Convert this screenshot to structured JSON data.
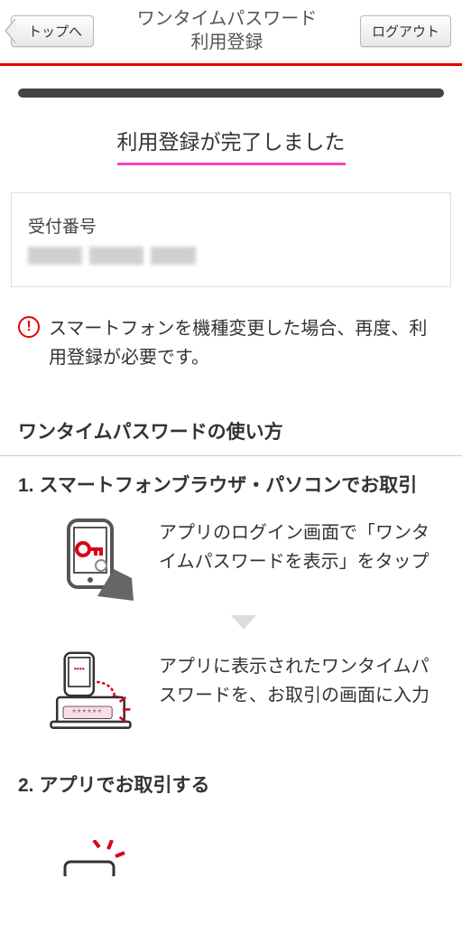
{
  "header": {
    "back_label": "トップへ",
    "title": "ワンタイムパスワード\n利用登録",
    "logout_label": "ログアウト"
  },
  "complete_message": "利用登録が完了しました",
  "receipt": {
    "label": "受付番号",
    "value_redacted": true
  },
  "warning": "スマートフォンを機種変更した場合、再度、利用登録が必要です。",
  "howto": {
    "title": "ワンタイムパスワードの使い方",
    "steps": [
      {
        "num": "1.",
        "title": "スマートフォンブラウザ・パソコンでお取引",
        "items": [
          {
            "desc": "アプリのログイン画面で「ワンタイムパスワードを表示」をタップ"
          },
          {
            "desc": "アプリに表示されたワンタイムパスワードを、お取引の画面に入力"
          }
        ]
      },
      {
        "num": "2.",
        "title": "アプリでお取引する",
        "items": []
      }
    ]
  }
}
